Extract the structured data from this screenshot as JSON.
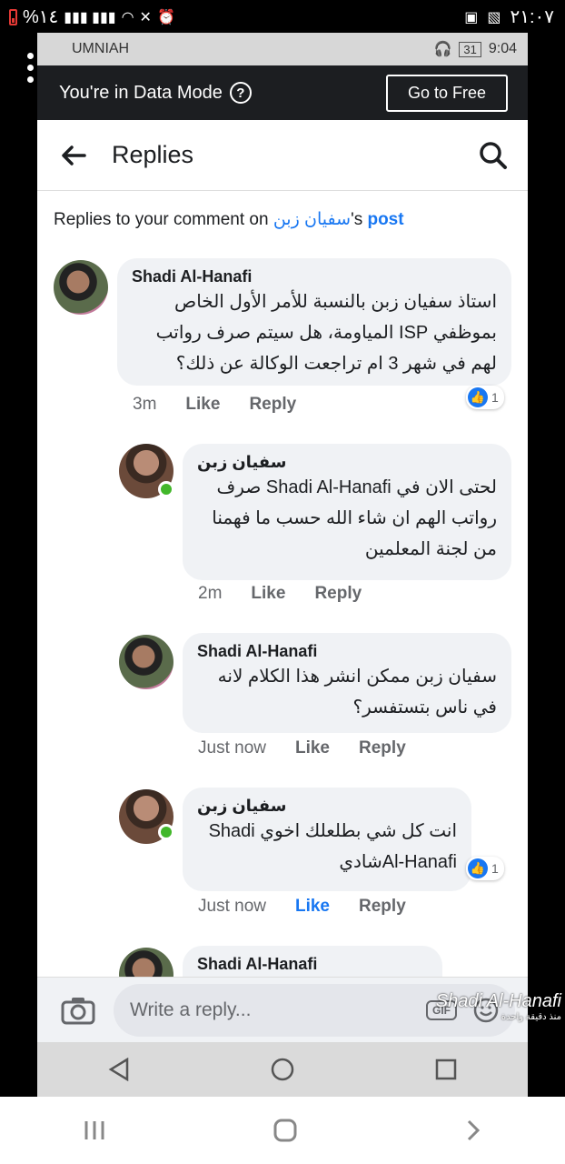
{
  "outer_status": {
    "left_text": "%١٤",
    "time": "٢١:٠٧"
  },
  "inner_status": {
    "carrier": "UMNIAH",
    "battery": "31",
    "time": "9:04"
  },
  "data_mode": {
    "text": "You're in Data Mode",
    "button": "Go to Free"
  },
  "header": {
    "title": "Replies"
  },
  "subheader": {
    "prefix": "Replies to your comment on ",
    "name": "سفيان زبن",
    "middle": "'s ",
    "link": "post"
  },
  "comments": [
    {
      "name": "Shadi Al-Hanafi",
      "text": "استاذ سفيان زبن بالنسبة للأمر الأول الخاص بموظفي ISP المياومة، هل سيتم صرف رواتب لهم في شهر 3 ام تراجعت الوكالة عن ذلك؟",
      "time": "3m",
      "like": "Like",
      "reply": "Reply",
      "reactions": "1"
    },
    {
      "name": "سفيان زبن",
      "text": "لحتى الان في Shadi Al-Hanafi صرف رواتب الهم ان شاء الله حسب ما فهمنا من لجنة المعلمين",
      "time": "2m",
      "like": "Like",
      "reply": "Reply"
    },
    {
      "name": "Shadi Al-Hanafi",
      "text": "سفيان زبن ممكن انشر هذا الكلام لانه في ناس بتستفسر؟",
      "time": "Just now",
      "like": "Like",
      "reply": "Reply"
    },
    {
      "name": "سفيان زبن",
      "text": "انت كل شي بطلعلك اخوي Shadi Al-Hanafiشادي",
      "time": "Just now",
      "like": "Like",
      "reply": "Reply",
      "reactions": "1"
    },
    {
      "name": "Shadi Al-Hanafi"
    }
  ],
  "reply_input": {
    "placeholder": "Write a reply...",
    "gif": "GIF"
  },
  "watermark": {
    "name": "Shadi Al-Hanafi",
    "sub": "منذ دقيقة واحدة"
  },
  "icons": [
    "back-arrow-icon",
    "search-icon",
    "camera-icon",
    "gif-icon",
    "emoji-icon",
    "like-thumb-icon"
  ]
}
